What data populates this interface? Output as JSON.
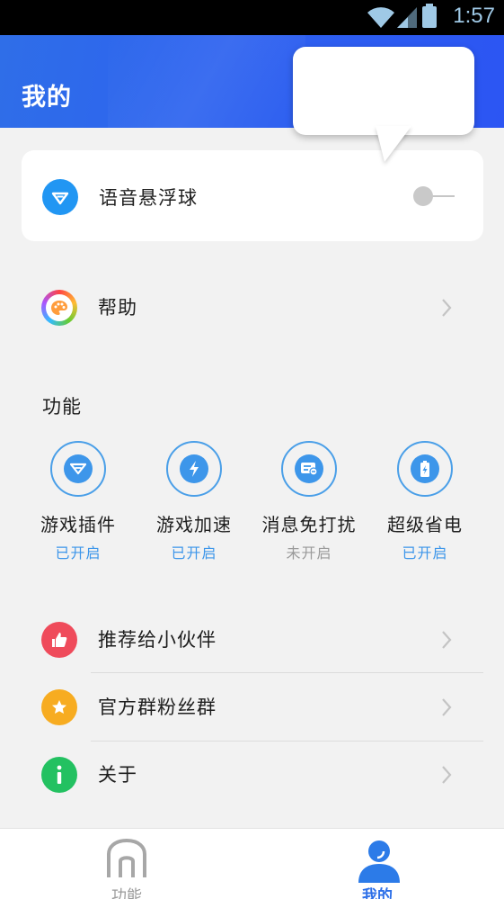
{
  "status_bar": {
    "time": "1:57"
  },
  "header": {
    "title": "我的"
  },
  "voice_ball": {
    "label": "语音悬浮球",
    "enabled": false
  },
  "help": {
    "label": "帮助"
  },
  "features": {
    "section_title": "功能",
    "items": [
      {
        "label": "游戏插件",
        "status": "已开启",
        "icon": "diamond-icon"
      },
      {
        "label": "游戏加速",
        "status": "已开启",
        "icon": "lightning-icon"
      },
      {
        "label": "消息免打扰",
        "status": "未开启",
        "icon": "message-mute-icon"
      },
      {
        "label": "超级省电",
        "status": "已开启",
        "icon": "battery-bolt-icon"
      }
    ]
  },
  "list": [
    {
      "label": "推荐给小伙伴",
      "icon": "thumbs-up-icon",
      "color": "#ef4b5b"
    },
    {
      "label": "官方群粉丝群",
      "icon": "star-icon",
      "color": "#f7ac21"
    },
    {
      "label": "关于",
      "icon": "info-icon",
      "color": "#23c161"
    }
  ],
  "bottom_nav": [
    {
      "label": "功能",
      "icon": "home-icon",
      "active": false
    },
    {
      "label": "我的",
      "icon": "person-icon",
      "active": true
    }
  ],
  "colors": {
    "accent": "#2c6fe8",
    "header": "#2d63ef",
    "feature_blue": "#3d96ea"
  }
}
